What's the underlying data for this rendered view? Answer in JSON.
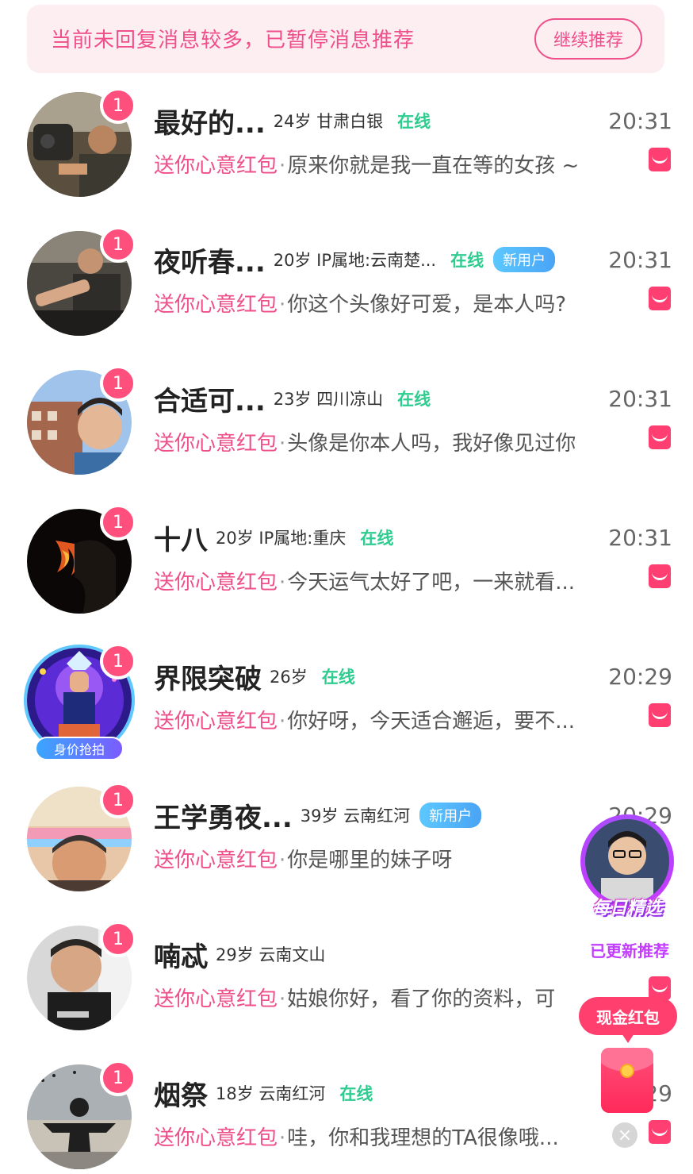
{
  "banner": {
    "text": "当前未回复消息较多，已暂停消息推荐",
    "button": "继续推荐"
  },
  "common": {
    "gift_text": "送你心意红包",
    "separator": "·",
    "online_label": "在线",
    "new_user_label": "新用户",
    "unread_count": "1"
  },
  "rows": [
    {
      "name": "最好的...",
      "meta": "24岁 甘肃白银",
      "online": "在线",
      "new_user": "",
      "time": "20:31",
      "message": "原来你就是我一直在等的女孩 ~"
    },
    {
      "name": "夜听春...",
      "meta": "20岁 IP属地:云南楚...",
      "online": "在线",
      "new_user": "新用户",
      "time": "20:31",
      "message": "你这个头像好可爱，是本人吗?"
    },
    {
      "name": "合适可...",
      "meta": "23岁 四川凉山",
      "online": "在线",
      "new_user": "",
      "time": "20:31",
      "message": "头像是你本人吗，我好像见过你"
    },
    {
      "name": "十八",
      "meta": "20岁 IP属地:重庆",
      "online": "在线",
      "new_user": "",
      "time": "20:31",
      "message": "今天运气太好了吧，一来就看..."
    },
    {
      "name": "界限突破",
      "meta": "26岁",
      "online": "在线",
      "new_user": "",
      "time": "20:29",
      "message": "你好呀，今天适合邂逅，要不...",
      "frame_tag": "身价抢拍"
    },
    {
      "name": "王学勇夜...",
      "meta": "39岁 云南红河",
      "online": "",
      "new_user": "新用户",
      "time": "20:29",
      "message": "你是哪里的妹子呀"
    },
    {
      "name": "喃忒",
      "meta": "29岁 云南文山",
      "online": "",
      "new_user": "",
      "time": "",
      "message": "姑娘你好，看了你的资料，可"
    },
    {
      "name": "烟祭",
      "meta": "18岁 云南红河",
      "online": "在线",
      "new_user": "",
      "time": "29",
      "message": "哇，你和我理想的TA很像哦..."
    }
  ],
  "floats": {
    "daily_title": "每日精选",
    "daily_sub": "已更新推荐",
    "cash_label": "现金红包",
    "close_glyph": "×"
  },
  "colors": {
    "accent_pink": "#ef4f8a",
    "online_green": "#2ecc8f",
    "new_user_blue": "#4aa4f5"
  }
}
